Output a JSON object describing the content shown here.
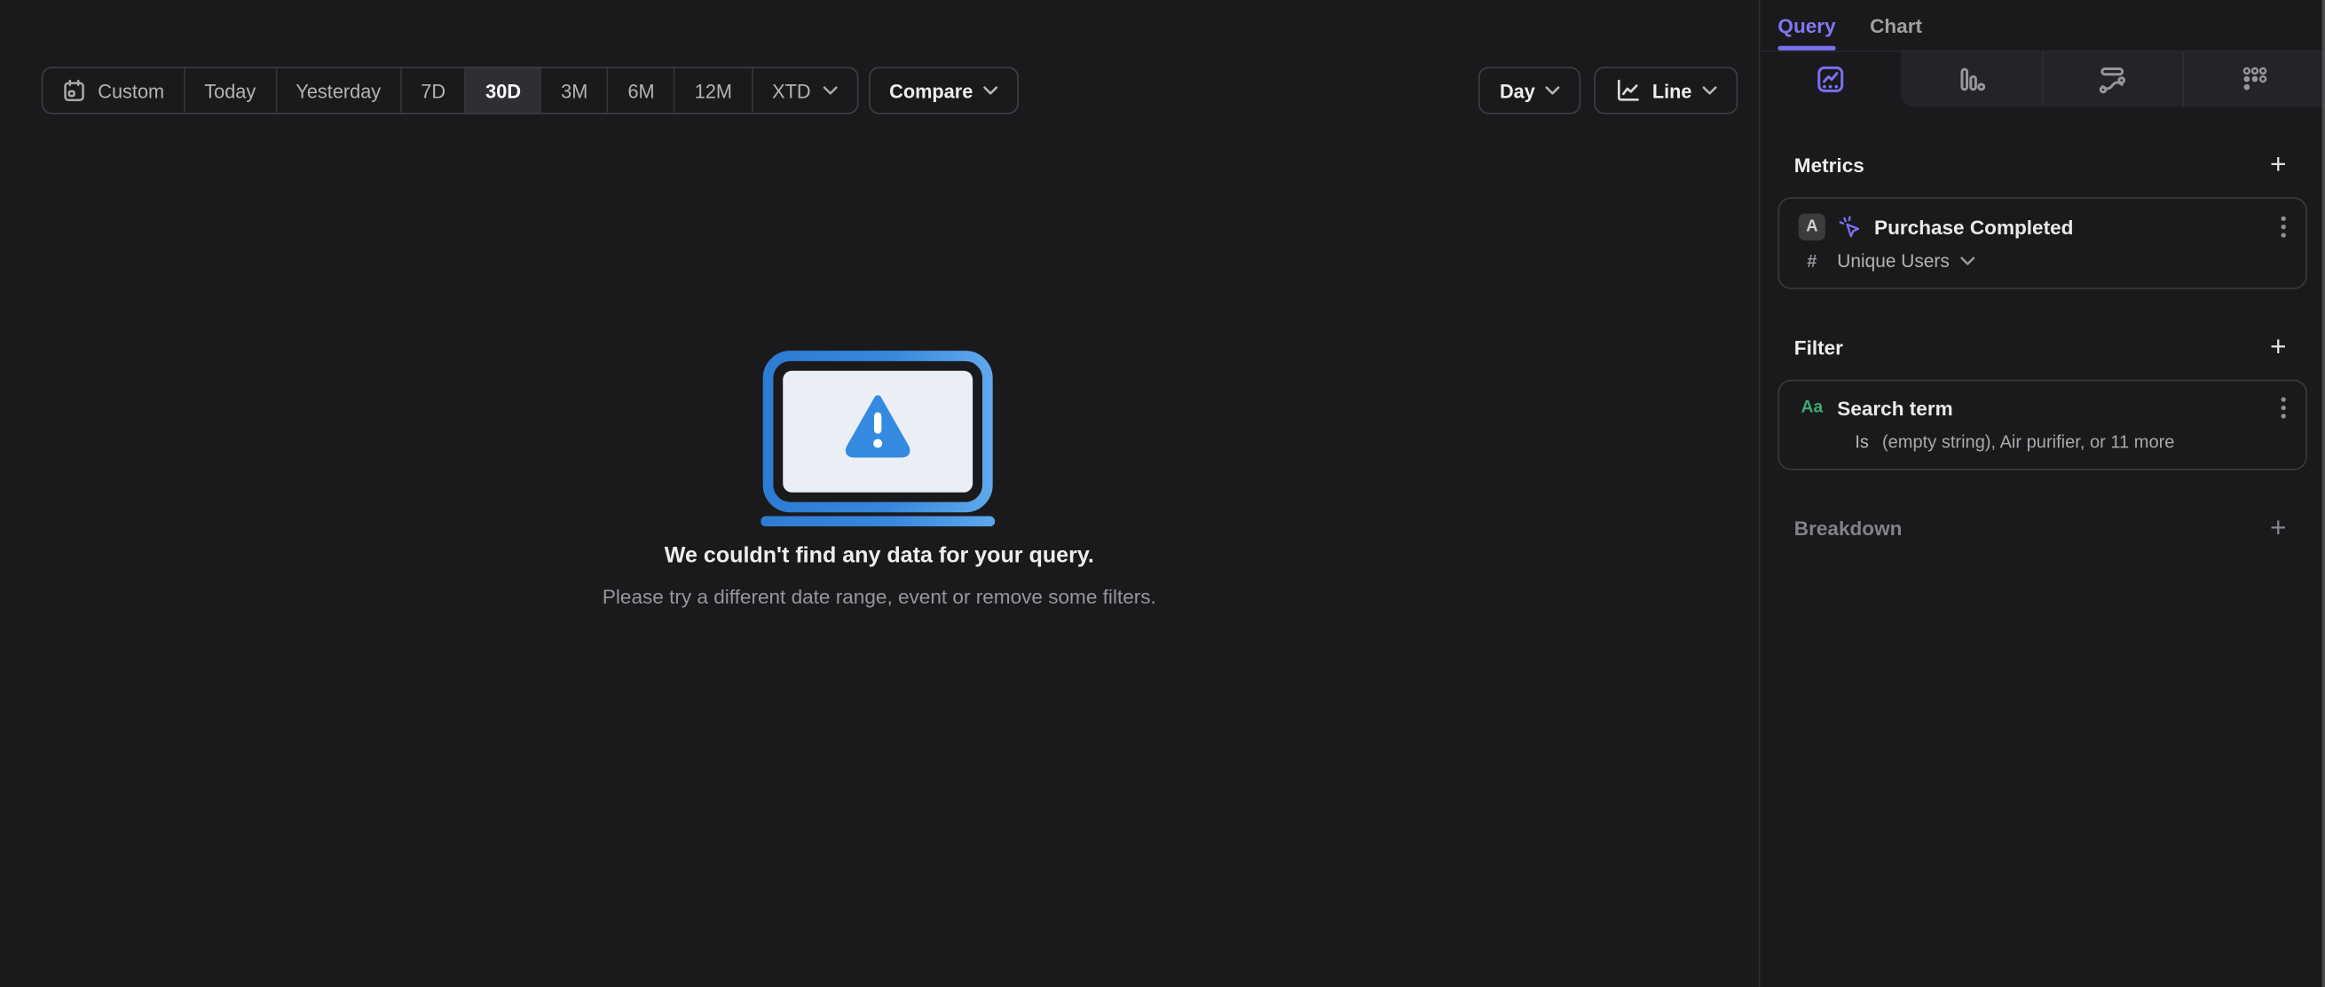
{
  "toolbar": {
    "ranges": [
      {
        "label": "Custom"
      },
      {
        "label": "Today"
      },
      {
        "label": "Yesterday"
      },
      {
        "label": "7D"
      },
      {
        "label": "30D"
      },
      {
        "label": "3M"
      },
      {
        "label": "6M"
      },
      {
        "label": "12M"
      },
      {
        "label": "XTD"
      }
    ],
    "active_range": "30D",
    "compare_label": "Compare"
  },
  "controls": {
    "interval_label": "Day",
    "chart_type_label": "Line"
  },
  "panel": {
    "tabs": {
      "query": "Query",
      "chart": "Chart"
    },
    "active_tab": "Query",
    "chart_type_tabs": [
      {
        "name": "insights-line",
        "active": true
      },
      {
        "name": "bar",
        "active": false
      },
      {
        "name": "flow",
        "active": false
      },
      {
        "name": "retention-grid",
        "active": false
      }
    ],
    "metrics": {
      "header": "Metrics",
      "add_icon": "+",
      "event": {
        "letter": "A",
        "name": "Purchase Completed",
        "aggregation_prefix": "#",
        "aggregation": "Unique Users"
      }
    },
    "filter": {
      "header": "Filter",
      "add_icon": "+",
      "item": {
        "type_icon": "Aa",
        "property": "Search term",
        "operator": "Is",
        "value": "(empty string), Air purifier, or 11 more"
      }
    },
    "breakdown": {
      "header": "Breakdown",
      "add_icon": "+"
    }
  },
  "empty_state": {
    "title": "We couldn't find any data for your query.",
    "subtitle": "Please try a different date range, event or remove some filters."
  },
  "colors": {
    "background": "#1a1a1c",
    "accent_purple": "#7b70f2",
    "property_green": "#3fa878",
    "illustration_blue": "#3787dd",
    "active_segment_bg": "#2d2f33"
  }
}
